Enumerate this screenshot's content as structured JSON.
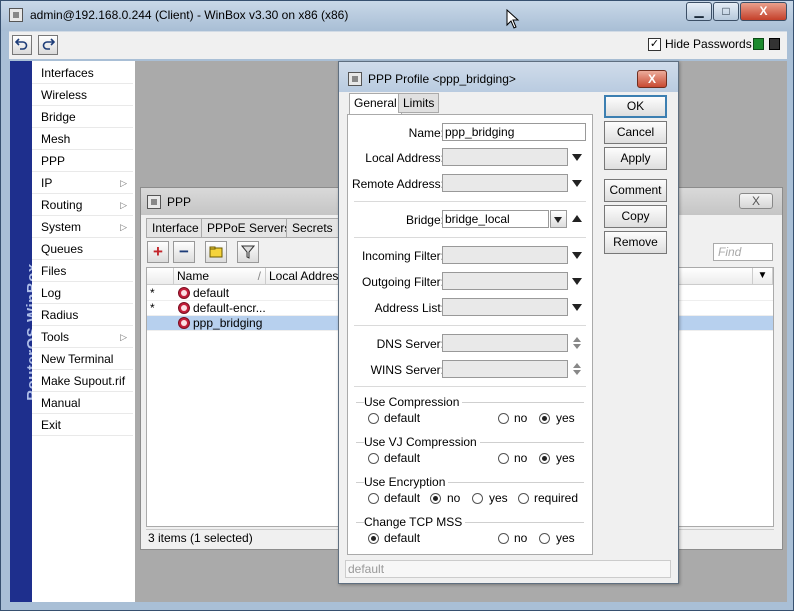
{
  "main_window": {
    "title": "admin@192.168.0.244 (Client) - WinBox v3.30 on x86 (x86)",
    "caption_buttons": {
      "minimize": "▁",
      "maximize": "□",
      "close": "X"
    }
  },
  "toolbar": {
    "undo_icon": "undo-arrow",
    "redo_icon": "redo-arrow",
    "hide_passwords_label": "Hide Passwords",
    "hide_passwords_checked": "✓",
    "lock_green_color": "#1c8a2e",
    "lock_black_color": "#333333"
  },
  "brand": {
    "text": "RouterOS WinBox",
    "color": "#1e2f8d"
  },
  "sidebar": {
    "items": [
      {
        "label": "Interfaces",
        "submenu": ""
      },
      {
        "label": "Wireless",
        "submenu": ""
      },
      {
        "label": "Bridge",
        "submenu": ""
      },
      {
        "label": "Mesh",
        "submenu": ""
      },
      {
        "label": "PPP",
        "submenu": ""
      },
      {
        "label": "IP",
        "submenu": "▷"
      },
      {
        "label": "Routing",
        "submenu": "▷"
      },
      {
        "label": "System",
        "submenu": "▷"
      },
      {
        "label": "Queues",
        "submenu": ""
      },
      {
        "label": "Files",
        "submenu": ""
      },
      {
        "label": "Log",
        "submenu": ""
      },
      {
        "label": "Radius",
        "submenu": ""
      },
      {
        "label": "Tools",
        "submenu": "▷"
      },
      {
        "label": "New Terminal",
        "submenu": ""
      },
      {
        "label": "Make Supout.rif",
        "submenu": ""
      },
      {
        "label": "Manual",
        "submenu": ""
      },
      {
        "label": "Exit",
        "submenu": ""
      }
    ]
  },
  "ppp_window": {
    "title": "PPP",
    "close_glyph": "X",
    "tabs": [
      "Interface",
      "PPPoE Servers",
      "Secrets"
    ],
    "tools": {
      "add": "+",
      "remove": "−"
    },
    "find_placeholder": "Find",
    "columns": [
      "Name",
      "Local Address"
    ],
    "sort_indicator": "/",
    "dropdown_glyph": "▼",
    "rows": [
      {
        "flag": "*",
        "name": "default",
        "selected": false
      },
      {
        "flag": "*",
        "name": "default-encr...",
        "selected": false
      },
      {
        "flag": "",
        "name": "ppp_bridging",
        "selected": true
      }
    ],
    "status": "3 items (1 selected)"
  },
  "profile_dialog": {
    "title": "PPP Profile <ppp_bridging>",
    "close_glyph": "X",
    "tabs": [
      "General",
      "Limits"
    ],
    "fields": {
      "name_label": "Name:",
      "name_value": "ppp_bridging",
      "local_address_label": "Local Address:",
      "local_address_value": "",
      "remote_address_label": "Remote Address:",
      "remote_address_value": "",
      "bridge_label": "Bridge:",
      "bridge_value": "bridge_local",
      "incoming_filter_label": "Incoming Filter:",
      "incoming_filter_value": "",
      "outgoing_filter_label": "Outgoing Filter:",
      "outgoing_filter_value": "",
      "address_list_label": "Address List:",
      "address_list_value": "",
      "dns_server_label": "DNS Server:",
      "dns_server_value": "",
      "wins_server_label": "WINS Server:",
      "wins_server_value": ""
    },
    "groups": {
      "use_compression": {
        "title": "Use Compression",
        "options": [
          "default",
          "no",
          "yes"
        ],
        "selected": "yes"
      },
      "use_vj_compression": {
        "title": "Use VJ Compression",
        "options": [
          "default",
          "no",
          "yes"
        ],
        "selected": "yes"
      },
      "use_encryption": {
        "title": "Use Encryption",
        "options": [
          "default",
          "no",
          "yes",
          "required"
        ],
        "selected": "no"
      },
      "change_tcp_mss": {
        "title": "Change TCP MSS",
        "options": [
          "default",
          "no",
          "yes"
        ],
        "selected": "default"
      }
    },
    "buttons": [
      "OK",
      "Cancel",
      "Apply",
      "Comment",
      "Copy",
      "Remove"
    ],
    "status": "default"
  }
}
